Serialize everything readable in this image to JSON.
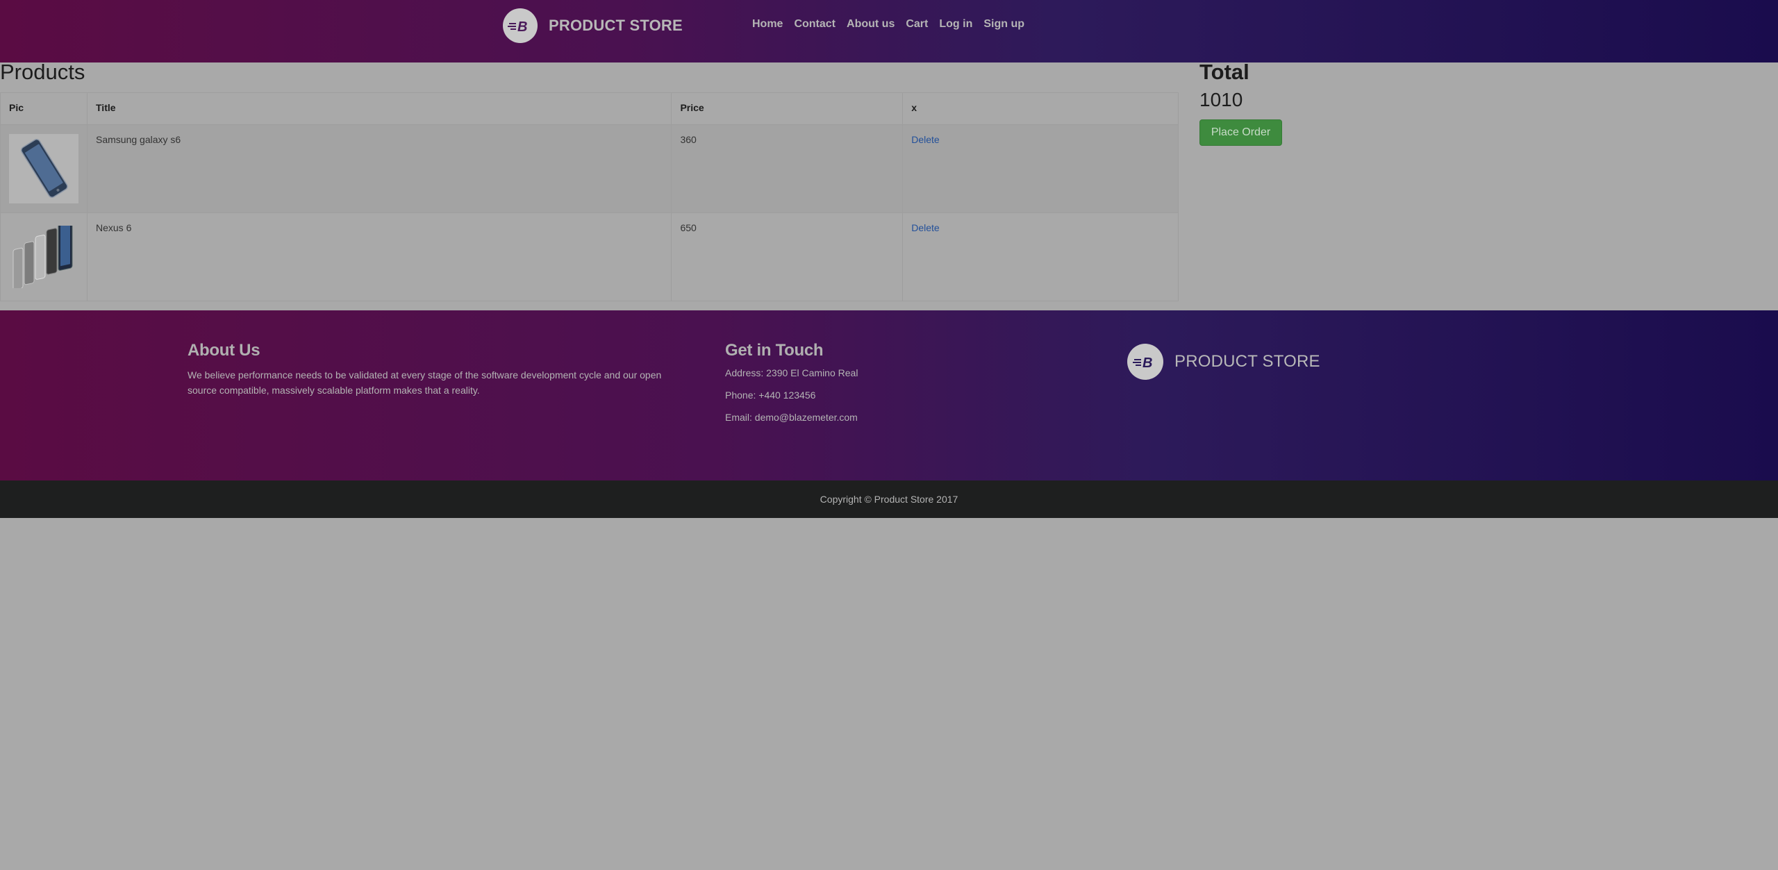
{
  "navbar": {
    "brand": "PRODUCT STORE",
    "logo_letter": "B",
    "links": [
      "Home",
      "Contact",
      "About us",
      "Cart",
      "Log in",
      "Sign up"
    ]
  },
  "products": {
    "title": "Products",
    "headers": [
      "Pic",
      "Title",
      "Price",
      "x"
    ],
    "rows": [
      {
        "title": "Samsung galaxy s6",
        "price": "360",
        "action": "Delete",
        "pic": "phone-image"
      },
      {
        "title": "Nexus 6",
        "price": "650",
        "action": "Delete",
        "pic": "phones-image"
      }
    ]
  },
  "total": {
    "title": "Total",
    "value": "1010",
    "button": "Place Order"
  },
  "footer": {
    "about_heading": "About Us",
    "about_text": "We believe performance needs to be validated at every stage of the software development cycle and our open source compatible, massively scalable platform makes that a reality.",
    "contact_heading": "Get in Touch",
    "address": "Address: 2390 El Camino Real",
    "phone": "Phone: +440 123456",
    "email": "Email: demo@blazemeter.com",
    "brand": "PRODUCT STORE",
    "copyright": "Copyright © Product Store 2017"
  },
  "colors": {
    "nav_gradient_start": "#5a0c43",
    "nav_gradient_end": "#1a0c4d",
    "place_order_button": "#3e8b3e",
    "delete_link": "#23509a",
    "page_background": "#a9a9a9"
  }
}
